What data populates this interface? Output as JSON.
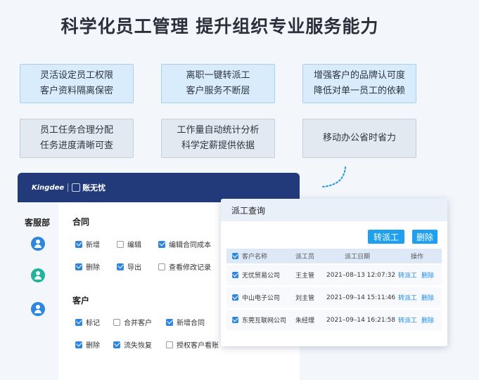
{
  "headline": "科学化员工管理  提升组织专业服务能力",
  "features": [
    {
      "line1": "灵活设定员工权限",
      "line2": "客户资料隔离保密"
    },
    {
      "line1": "离职一键转派工",
      "line2": "客户服务不断层"
    },
    {
      "line1": "增强客户的品牌认可度",
      "line2": "降低对单一员工的依赖"
    },
    {
      "line1": "员工任务合理分配",
      "line2": "任务进度清晰可查"
    },
    {
      "line1": "工作量自动统计分析",
      "line2": "科学定薪提供依据"
    },
    {
      "line1": "移动办公省时省力",
      "line2": ""
    }
  ],
  "app": {
    "logo_text": "Kingdee",
    "brand": "账无忧",
    "side_title": "客服部",
    "avatar_colors": [
      "#2f86e0",
      "#22b39a",
      "#2f86e0"
    ],
    "contract": {
      "title": "合同",
      "perms": [
        {
          "label": "新增",
          "checked": true
        },
        {
          "label": "编辑",
          "checked": false
        },
        {
          "label": "编辑合同成本",
          "checked": true
        },
        {
          "label": "删除",
          "checked": true
        },
        {
          "label": "导出",
          "checked": true
        },
        {
          "label": "查看修改记录",
          "checked": false
        }
      ]
    },
    "customer": {
      "title": "客户",
      "perms": [
        {
          "label": "标记",
          "checked": true
        },
        {
          "label": "合并客户",
          "checked": false
        },
        {
          "label": "新增合同",
          "checked": true
        },
        {
          "label": "删除",
          "checked": true
        },
        {
          "label": "流失恢复",
          "checked": true
        },
        {
          "label": "授权客户看账",
          "checked": false
        }
      ]
    }
  },
  "popup": {
    "title": "派工查询",
    "btn_transfer": "转派工",
    "btn_delete": "删除",
    "columns": [
      "客户名称",
      "派工员",
      "派工日期",
      "操作"
    ],
    "rows": [
      {
        "customer": "无忧贸易公司",
        "staff": "王主管",
        "date": "2021–08–13 12:07:32",
        "op1": "转派工",
        "op2": "删除"
      },
      {
        "customer": "中山电子公司",
        "staff": "刘主管",
        "date": "2021–09–14 15:11:46",
        "op1": "转派工",
        "op2": "删除"
      },
      {
        "customer": "东莞互联网公司",
        "staff": "朱经理",
        "date": "2021–09–14 16:21:58",
        "op1": "转派工",
        "op2": "删除"
      }
    ]
  },
  "colors": {
    "accent": "#1ea0ee",
    "nav": "#22397a",
    "check": "#2f86e0"
  }
}
